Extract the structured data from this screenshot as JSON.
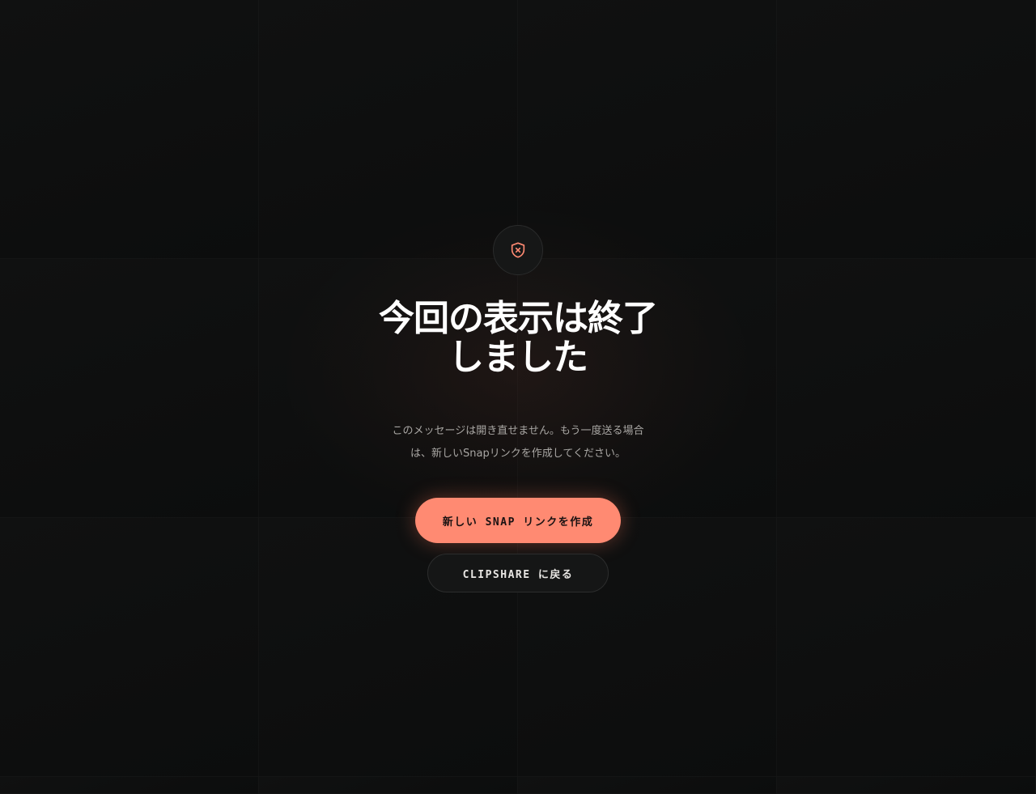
{
  "icon": {
    "name": "shield-x-icon",
    "color": "#ff8a72"
  },
  "title": {
    "line1": "今回の表示は終了",
    "line2": "しました"
  },
  "description": {
    "line1": "このメッセージは開き直せません。もう一度送る場合",
    "line2": "は、新しいSnapリンクを作成してください。"
  },
  "buttons": {
    "primary_label": "新しい SNAP リンクを作成",
    "secondary_label": "CLIPSHARE に戻る"
  },
  "colors": {
    "accent": "#ff8a72",
    "background": "#0c0d0d",
    "text": "#ffffff",
    "muted_text": "#a8a6a3"
  }
}
